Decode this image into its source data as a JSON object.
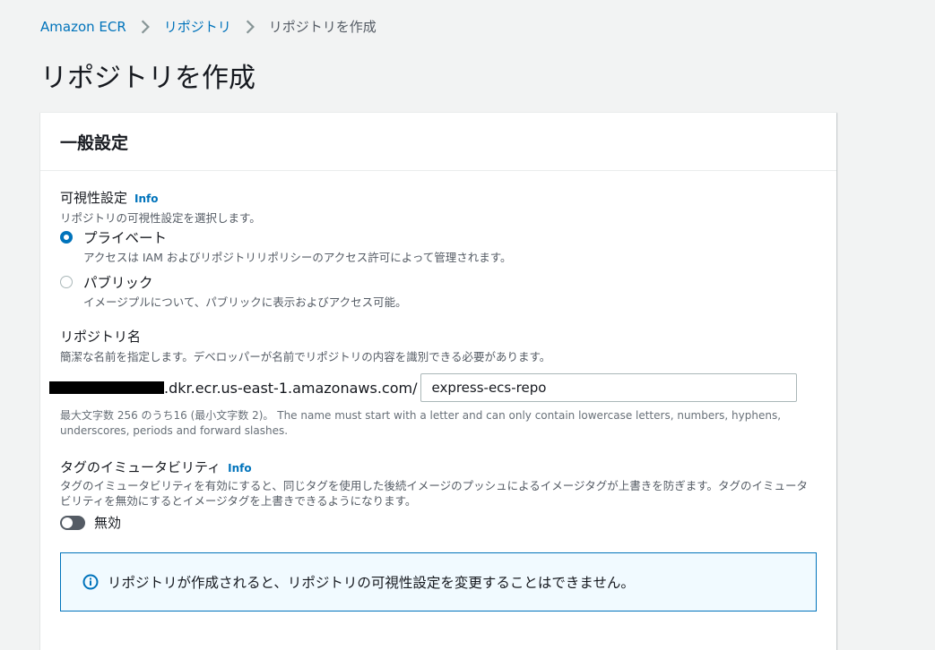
{
  "breadcrumb": {
    "items": [
      "Amazon ECR",
      "リポジトリ"
    ],
    "current": "リポジトリを作成"
  },
  "page_title": "リポジトリを作成",
  "panel": {
    "title": "一般設定",
    "visibility": {
      "label": "可視性設定",
      "info": "Info",
      "description": "リポジトリの可視性設定を選択します。",
      "options": [
        {
          "label": "プライベート",
          "description": "アクセスは IAM およびリポジトリリポリシーのアクセス許可によって管理されます。",
          "selected": true
        },
        {
          "label": "パブリック",
          "description": "イメージプルについて、パブリックに表示およびアクセス可能。",
          "selected": false
        }
      ]
    },
    "repo_name": {
      "label": "リポジトリ名",
      "description": "簡潔な名前を指定します。デベロッパーが名前でリポジトリの内容を識別できる必要があります。",
      "prefix": ".dkr.ecr.us-east-1.amazonaws.com/",
      "value": "express-ecs-repo",
      "constraint": "最大文字数 256 のうち16 (最小文字数 2)。 The name must start with a letter and can only contain lowercase letters, numbers, hyphens, underscores, periods and forward slashes."
    },
    "tag_immutability": {
      "label": "タグのイミュータビリティ",
      "info": "Info",
      "description": "タグのイミュータビリティを有効にすると、同じタグを使用した後続イメージのプッシュによるイメージタグが上書きを防ぎます。タグのイミュータビリティを無効にするとイメージタグを上書きできるようになります。",
      "toggle_label": "無効",
      "enabled": false
    },
    "alert": {
      "text": "リポジトリが作成されると、リポジトリの可視性設定を変更することはできません。"
    }
  },
  "colors": {
    "link": "#0073bb",
    "background": "#f2f3f3",
    "alert_bg": "#f1faff"
  }
}
